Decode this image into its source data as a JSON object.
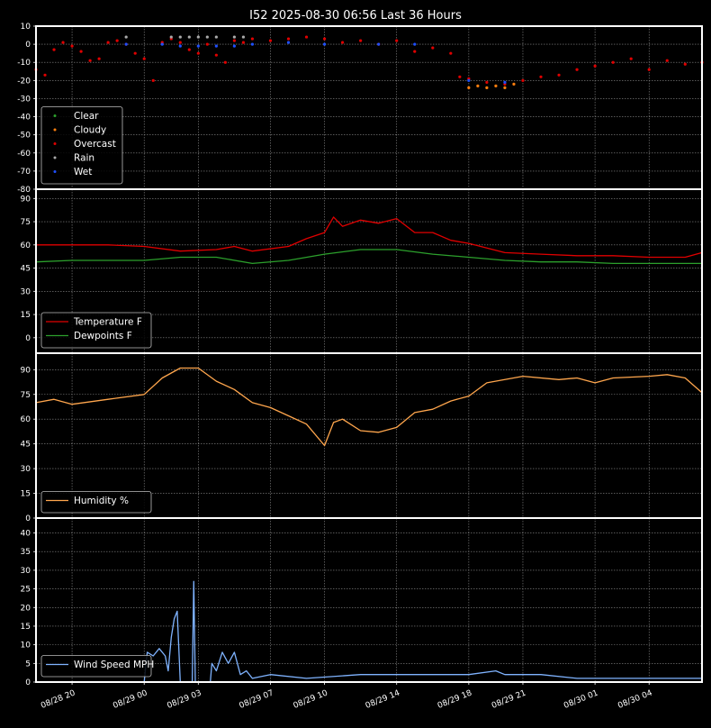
{
  "title": "I52 2025-08-30 06:56 Last 36 Hours",
  "x_axis": {
    "range": [
      "2025-08-28 18:00",
      "2025-08-30 06:56"
    ],
    "ticks": [
      {
        "t": "2025-08-28 20:00",
        "label": "08/28 20"
      },
      {
        "t": "2025-08-29 00:00",
        "label": "08/29 00"
      },
      {
        "t": "2025-08-29 03:00",
        "label": "08/29 03"
      },
      {
        "t": "2025-08-29 07:00",
        "label": "08/29 07"
      },
      {
        "t": "2025-08-29 10:00",
        "label": "08/29 10"
      },
      {
        "t": "2025-08-29 14:00",
        "label": "08/29 14"
      },
      {
        "t": "2025-08-29 18:00",
        "label": "08/29 18"
      },
      {
        "t": "2025-08-29 21:00",
        "label": "08/29 21"
      },
      {
        "t": "2025-08-30 01:00",
        "label": "08/30 01"
      },
      {
        "t": "2025-08-30 04:00",
        "label": "08/30 04"
      }
    ]
  },
  "colors": {
    "clear": "#2ca02c",
    "cloudy": "#ff7f0e",
    "overcast": "#e00000",
    "rain": "#aaaaaa",
    "wet": "#1f50ff",
    "temperature": "#e00000",
    "dewpoint": "#2ca02c",
    "humidity": "#ffa64d",
    "wind": "#7fb3ff"
  },
  "chart_data": [
    {
      "type": "scatter",
      "ylim": [
        -80,
        10
      ],
      "yticks": [
        10,
        0,
        -10,
        -20,
        -30,
        -40,
        -50,
        -60,
        -70,
        -80
      ],
      "legend_position": "lower-left",
      "grid": true,
      "series": [
        {
          "name": "Clear",
          "color_key": "clear",
          "points": []
        },
        {
          "name": "Cloudy",
          "color_key": "cloudy",
          "points": [
            [
              "2025-08-29 18:00",
              -24
            ],
            [
              "2025-08-29 18:30",
              -23
            ],
            [
              "2025-08-29 19:00",
              -24
            ],
            [
              "2025-08-29 19:30",
              -23
            ],
            [
              "2025-08-29 20:00",
              -24
            ],
            [
              "2025-08-29 20:30",
              -22
            ]
          ]
        },
        {
          "name": "Overcast",
          "color_key": "overcast",
          "points": [
            [
              "2025-08-28 18:00",
              -14
            ],
            [
              "2025-08-28 18:30",
              -17
            ],
            [
              "2025-08-28 19:00",
              -3
            ],
            [
              "2025-08-28 19:30",
              1
            ],
            [
              "2025-08-28 20:00",
              -1
            ],
            [
              "2025-08-28 20:30",
              -4
            ],
            [
              "2025-08-28 21:00",
              -9
            ],
            [
              "2025-08-28 21:30",
              -8
            ],
            [
              "2025-08-28 22:00",
              1
            ],
            [
              "2025-08-28 22:30",
              2
            ],
            [
              "2025-08-28 23:00",
              0
            ],
            [
              "2025-08-28 23:30",
              -5
            ],
            [
              "2025-08-29 00:00",
              -8
            ],
            [
              "2025-08-29 00:30",
              -20
            ],
            [
              "2025-08-29 01:00",
              1
            ],
            [
              "2025-08-29 01:30",
              3
            ],
            [
              "2025-08-29 02:00",
              1
            ],
            [
              "2025-08-29 02:30",
              -3
            ],
            [
              "2025-08-29 03:00",
              -5
            ],
            [
              "2025-08-29 03:30",
              0
            ],
            [
              "2025-08-29 04:00",
              -6
            ],
            [
              "2025-08-29 04:30",
              -10
            ],
            [
              "2025-08-29 05:00",
              2
            ],
            [
              "2025-08-29 05:30",
              1
            ],
            [
              "2025-08-29 06:00",
              3
            ],
            [
              "2025-08-29 07:00",
              2
            ],
            [
              "2025-08-29 08:00",
              3
            ],
            [
              "2025-08-29 09:00",
              4
            ],
            [
              "2025-08-29 10:00",
              3
            ],
            [
              "2025-08-29 11:00",
              1
            ],
            [
              "2025-08-29 12:00",
              2
            ],
            [
              "2025-08-29 13:00",
              0
            ],
            [
              "2025-08-29 14:00",
              2
            ],
            [
              "2025-08-29 15:00",
              -4
            ],
            [
              "2025-08-29 16:00",
              -2
            ],
            [
              "2025-08-29 17:00",
              -5
            ],
            [
              "2025-08-29 17:30",
              -18
            ],
            [
              "2025-08-29 18:00",
              -19
            ],
            [
              "2025-08-29 19:00",
              -21
            ],
            [
              "2025-08-29 20:00",
              -22
            ],
            [
              "2025-08-29 21:00",
              -20
            ],
            [
              "2025-08-29 22:00",
              -18
            ],
            [
              "2025-08-29 23:00",
              -17
            ],
            [
              "2025-08-30 00:00",
              -14
            ],
            [
              "2025-08-30 01:00",
              -12
            ],
            [
              "2025-08-30 02:00",
              -10
            ],
            [
              "2025-08-30 03:00",
              -8
            ],
            [
              "2025-08-30 04:00",
              -14
            ],
            [
              "2025-08-30 05:00",
              -9
            ],
            [
              "2025-08-30 06:00",
              -11
            ],
            [
              "2025-08-30 06:56",
              -10
            ]
          ]
        },
        {
          "name": "Rain",
          "color_key": "rain",
          "points": [
            [
              "2025-08-28 23:00",
              4
            ],
            [
              "2025-08-29 01:30",
              4
            ],
            [
              "2025-08-29 02:00",
              4
            ],
            [
              "2025-08-29 02:30",
              4
            ],
            [
              "2025-08-29 03:00",
              4
            ],
            [
              "2025-08-29 03:30",
              4
            ],
            [
              "2025-08-29 04:00",
              4
            ],
            [
              "2025-08-29 05:00",
              4
            ],
            [
              "2025-08-29 05:30",
              4
            ]
          ]
        },
        {
          "name": "Wet",
          "color_key": "wet",
          "points": [
            [
              "2025-08-28 23:00",
              0
            ],
            [
              "2025-08-29 01:00",
              0
            ],
            [
              "2025-08-29 02:00",
              -1
            ],
            [
              "2025-08-29 03:00",
              -1
            ],
            [
              "2025-08-29 04:00",
              -1
            ],
            [
              "2025-08-29 05:00",
              -1
            ],
            [
              "2025-08-29 06:00",
              0
            ],
            [
              "2025-08-29 08:00",
              1
            ],
            [
              "2025-08-29 10:00",
              0
            ],
            [
              "2025-08-29 13:00",
              0
            ],
            [
              "2025-08-29 15:00",
              0
            ],
            [
              "2025-08-29 18:00",
              -20
            ],
            [
              "2025-08-29 20:00",
              -21
            ]
          ]
        }
      ]
    },
    {
      "type": "line",
      "ylim": [
        -10,
        96
      ],
      "yticks": [
        90,
        75,
        60,
        45,
        30,
        15,
        0
      ],
      "legend_position": "lower-left",
      "grid": true,
      "series": [
        {
          "name": "Temperature F",
          "color_key": "temperature",
          "points": [
            [
              "2025-08-28 18:00",
              60
            ],
            [
              "2025-08-28 20:00",
              60
            ],
            [
              "2025-08-28 22:00",
              60
            ],
            [
              "2025-08-29 00:00",
              59
            ],
            [
              "2025-08-29 02:00",
              56
            ],
            [
              "2025-08-29 04:00",
              57
            ],
            [
              "2025-08-29 05:00",
              59
            ],
            [
              "2025-08-29 06:00",
              56
            ],
            [
              "2025-08-29 08:00",
              59
            ],
            [
              "2025-08-29 09:00",
              64
            ],
            [
              "2025-08-29 10:00",
              68
            ],
            [
              "2025-08-29 10:30",
              78
            ],
            [
              "2025-08-29 11:00",
              72
            ],
            [
              "2025-08-29 12:00",
              76
            ],
            [
              "2025-08-29 13:00",
              74
            ],
            [
              "2025-08-29 14:00",
              77
            ],
            [
              "2025-08-29 15:00",
              68
            ],
            [
              "2025-08-29 16:00",
              68
            ],
            [
              "2025-08-29 17:00",
              63
            ],
            [
              "2025-08-29 18:00",
              61
            ],
            [
              "2025-08-29 20:00",
              55
            ],
            [
              "2025-08-29 22:00",
              54
            ],
            [
              "2025-08-30 00:00",
              53
            ],
            [
              "2025-08-30 02:00",
              53
            ],
            [
              "2025-08-30 04:00",
              52
            ],
            [
              "2025-08-30 06:00",
              52
            ],
            [
              "2025-08-30 06:56",
              55
            ]
          ]
        },
        {
          "name": "Dewpoints F",
          "color_key": "dewpoint",
          "points": [
            [
              "2025-08-28 18:00",
              49
            ],
            [
              "2025-08-28 20:00",
              50
            ],
            [
              "2025-08-28 22:00",
              50
            ],
            [
              "2025-08-29 00:00",
              50
            ],
            [
              "2025-08-29 02:00",
              52
            ],
            [
              "2025-08-29 04:00",
              52
            ],
            [
              "2025-08-29 06:00",
              48
            ],
            [
              "2025-08-29 08:00",
              50
            ],
            [
              "2025-08-29 10:00",
              54
            ],
            [
              "2025-08-29 12:00",
              57
            ],
            [
              "2025-08-29 14:00",
              57
            ],
            [
              "2025-08-29 16:00",
              54
            ],
            [
              "2025-08-29 18:00",
              52
            ],
            [
              "2025-08-29 20:00",
              50
            ],
            [
              "2025-08-29 22:00",
              49
            ],
            [
              "2025-08-30 00:00",
              49
            ],
            [
              "2025-08-30 02:00",
              48
            ],
            [
              "2025-08-30 04:00",
              48
            ],
            [
              "2025-08-30 06:56",
              48
            ]
          ]
        }
      ]
    },
    {
      "type": "line",
      "ylim": [
        0,
        100
      ],
      "yticks": [
        90,
        75,
        60,
        45,
        30,
        15,
        0
      ],
      "legend_position": "lower-left",
      "grid": true,
      "series": [
        {
          "name": "Humidity %",
          "color_key": "humidity",
          "points": [
            [
              "2025-08-28 18:00",
              70
            ],
            [
              "2025-08-28 19:00",
              72
            ],
            [
              "2025-08-28 20:00",
              69
            ],
            [
              "2025-08-28 22:00",
              72
            ],
            [
              "2025-08-29 00:00",
              75
            ],
            [
              "2025-08-29 01:00",
              85
            ],
            [
              "2025-08-29 02:00",
              91
            ],
            [
              "2025-08-29 03:00",
              91
            ],
            [
              "2025-08-29 04:00",
              83
            ],
            [
              "2025-08-29 05:00",
              78
            ],
            [
              "2025-08-29 06:00",
              70
            ],
            [
              "2025-08-29 07:00",
              67
            ],
            [
              "2025-08-29 08:00",
              62
            ],
            [
              "2025-08-29 09:00",
              57
            ],
            [
              "2025-08-29 10:00",
              44
            ],
            [
              "2025-08-29 10:30",
              58
            ],
            [
              "2025-08-29 11:00",
              60
            ],
            [
              "2025-08-29 12:00",
              53
            ],
            [
              "2025-08-29 13:00",
              52
            ],
            [
              "2025-08-29 14:00",
              55
            ],
            [
              "2025-08-29 15:00",
              64
            ],
            [
              "2025-08-29 16:00",
              66
            ],
            [
              "2025-08-29 17:00",
              71
            ],
            [
              "2025-08-29 18:00",
              74
            ],
            [
              "2025-08-29 19:00",
              82
            ],
            [
              "2025-08-29 21:00",
              86
            ],
            [
              "2025-08-29 23:00",
              84
            ],
            [
              "2025-08-30 00:00",
              85
            ],
            [
              "2025-08-30 01:00",
              82
            ],
            [
              "2025-08-30 02:00",
              85
            ],
            [
              "2025-08-30 04:00",
              86
            ],
            [
              "2025-08-30 05:00",
              87
            ],
            [
              "2025-08-30 06:00",
              85
            ],
            [
              "2025-08-30 06:56",
              76
            ]
          ]
        }
      ]
    },
    {
      "type": "line",
      "ylim": [
        0,
        44
      ],
      "yticks": [
        40,
        35,
        30,
        25,
        20,
        15,
        10,
        5,
        0
      ],
      "legend_position": "lower-left",
      "grid": true,
      "series": [
        {
          "name": "Wind Speed MPH",
          "color_key": "wind",
          "points": [
            [
              "2025-08-29 00:00",
              0
            ],
            [
              "2025-08-29 00:10",
              8
            ],
            [
              "2025-08-29 00:30",
              7
            ],
            [
              "2025-08-29 00:50",
              9
            ],
            [
              "2025-08-29 01:10",
              7
            ],
            [
              "2025-08-29 01:20",
              3
            ],
            [
              "2025-08-29 01:30",
              12
            ],
            [
              "2025-08-29 01:40",
              17
            ],
            [
              "2025-08-29 01:50",
              19
            ],
            [
              "2025-08-29 02:00",
              0
            ],
            [
              "2025-08-29 02:40",
              0
            ],
            [
              "2025-08-29 02:45",
              27
            ],
            [
              "2025-08-29 02:50",
              0
            ],
            [
              "2025-08-29 03:40",
              0
            ],
            [
              "2025-08-29 03:45",
              5
            ],
            [
              "2025-08-29 04:00",
              3
            ],
            [
              "2025-08-29 04:20",
              8
            ],
            [
              "2025-08-29 04:40",
              5
            ],
            [
              "2025-08-29 05:00",
              8
            ],
            [
              "2025-08-29 05:20",
              2
            ],
            [
              "2025-08-29 05:40",
              3
            ],
            [
              "2025-08-29 06:00",
              1
            ],
            [
              "2025-08-29 07:00",
              2
            ],
            [
              "2025-08-29 09:00",
              1
            ],
            [
              "2025-08-29 12:00",
              2
            ],
            [
              "2025-08-29 15:00",
              2
            ],
            [
              "2025-08-29 18:00",
              2
            ],
            [
              "2025-08-29 19:30",
              3
            ],
            [
              "2025-08-29 20:00",
              2
            ],
            [
              "2025-08-29 22:00",
              2
            ],
            [
              "2025-08-30 00:00",
              1
            ],
            [
              "2025-08-30 02:00",
              1
            ],
            [
              "2025-08-30 06:56",
              1
            ]
          ]
        }
      ]
    }
  ]
}
